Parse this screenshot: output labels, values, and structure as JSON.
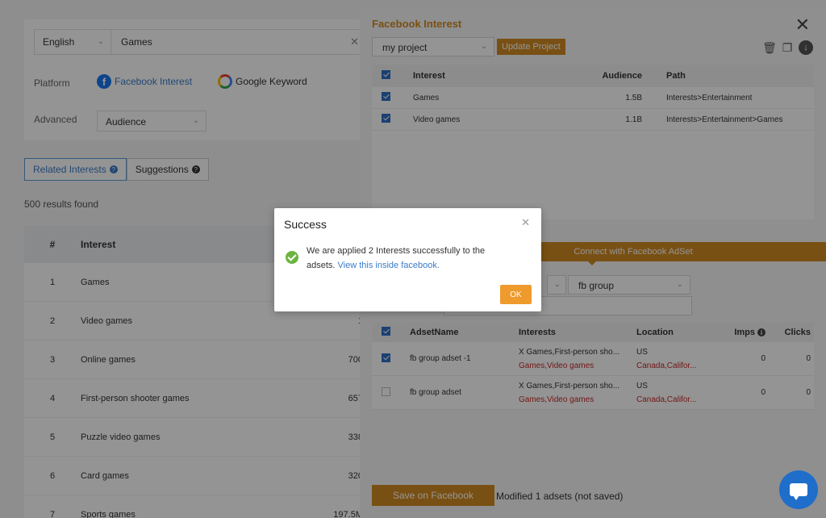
{
  "search": {
    "language": "English",
    "query": "Games",
    "clear": "✕"
  },
  "platform": {
    "label": "Platform",
    "facebook": "Facebook Interest",
    "google": "Google Keyword"
  },
  "advanced": {
    "label": "Advanced",
    "value": "Audience"
  },
  "tabs": {
    "related": "Related Interests",
    "suggestions": "Suggestions"
  },
  "results_text": "500 results found",
  "left_table": {
    "headers": {
      "num": "#",
      "interest": "Interest"
    },
    "rows": [
      {
        "num": "1",
        "interest": "Games",
        "audience": ""
      },
      {
        "num": "2",
        "interest": "Video games",
        "audience": "1"
      },
      {
        "num": "3",
        "interest": "Online games",
        "audience": "700"
      },
      {
        "num": "4",
        "interest": "First-person shooter games",
        "audience": "657"
      },
      {
        "num": "5",
        "interest": "Puzzle video games",
        "audience": "338"
      },
      {
        "num": "6",
        "interest": "Card games",
        "audience": "320"
      },
      {
        "num": "7",
        "interest": "Sports games",
        "audience": "197.5M"
      }
    ]
  },
  "panel": {
    "title": "Facebook Interest",
    "project": "my project",
    "update_button": "Update Project",
    "interest_table": {
      "headers": {
        "interest": "Interest",
        "audience": "Audience",
        "path": "Path"
      },
      "rows": [
        {
          "interest": "Games",
          "audience": "1.5B",
          "path": "Interests>Entertainment"
        },
        {
          "interest": "Video games",
          "audience": "1.1B",
          "path": "Interests>Entertainment>Games"
        }
      ]
    },
    "connect_label": "Connect with Facebook AdSet",
    "adset_group": "fb group",
    "adset_table": {
      "headers": {
        "name": "AdsetName",
        "interests": "Interests",
        "location": "Location",
        "imps": "Imps",
        "clicks": "Clicks"
      },
      "rows": [
        {
          "checked": true,
          "name": "fb group adset -1",
          "interests1": "X Games,First-person sho...",
          "interests2": "Games,Video games",
          "location1": "US",
          "location2": "Canada,Califor...",
          "imps": "0",
          "clicks": "0"
        },
        {
          "checked": false,
          "name": "fb group adset",
          "interests1": "X Games,First-person sho...",
          "interests2": "Games,Video games",
          "location1": "US",
          "location2": "Canada,Califor...",
          "imps": "0",
          "clicks": "0"
        }
      ]
    },
    "save_button": "Save on Facebook",
    "save_status": "Modified 1 adsets (not saved)"
  },
  "modal": {
    "title": "Success",
    "message": "We are applied 2 Interests successfully to the adsets.",
    "link": "View this inside facebook.",
    "ok": "OK"
  },
  "colors": {
    "accent": "#d08a22",
    "primary": "#3a7bc8",
    "success": "#6cb33f"
  }
}
